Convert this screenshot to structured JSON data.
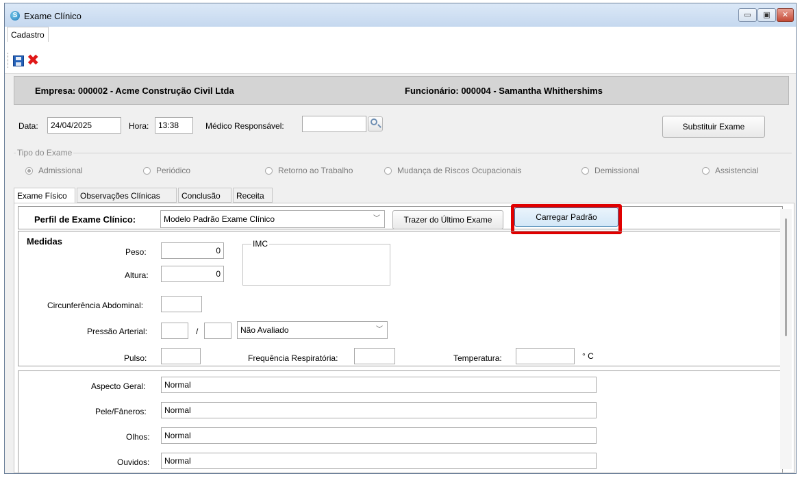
{
  "window": {
    "title": "Exame Clínico",
    "app_icon": "app-logo-icon",
    "min_label": "▭",
    "max_label": "▣",
    "close_label": "✕"
  },
  "menu": {
    "items": [
      "Cadastro"
    ]
  },
  "toolbar": {
    "save_icon": "save-icon",
    "delete_icon": "delete-icon",
    "delete_glyph": "✖"
  },
  "header": {
    "empresa": "Empresa:  000002 - Acme Construção Civil Ltda",
    "funcionario": "Funcionário:  000004 - Samantha Whithershims"
  },
  "form": {
    "data_label": "Data:",
    "data_value": "24/04/2025",
    "hora_label": "Hora:",
    "hora_value": "13:38",
    "medico_label": "Médico Responsável:",
    "medico_value": "",
    "substituir_label": "Substituir Exame"
  },
  "tipo_exame": {
    "legend": "Tipo do Exame",
    "options": [
      {
        "label": "Admissional",
        "selected": true
      },
      {
        "label": "Periódico",
        "selected": false
      },
      {
        "label": "Retorno ao Trabalho",
        "selected": false
      },
      {
        "label": "Mudança de Riscos Ocupacionais",
        "selected": false
      },
      {
        "label": "Demissional",
        "selected": false
      },
      {
        "label": "Assistencial",
        "selected": false
      }
    ]
  },
  "tabs": [
    "Exame Físico",
    "Observações Clínicas",
    "Conclusão",
    "Receita"
  ],
  "perfil": {
    "label": "Perfil de Exame Clínico:",
    "value": "Modelo Padrão Exame Clínico",
    "trazer_label": "Trazer do Último Exame",
    "carregar_label": "Carregar Padrão"
  },
  "medidas": {
    "title": "Medidas",
    "peso_label": "Peso:",
    "peso_value": "0",
    "altura_label": "Altura:",
    "altura_value": "0",
    "imc_label": "IMC",
    "circ_label": "Circunferência Abdominal:",
    "pressao_label": "Pressão Arterial:",
    "pressao_sep": "/",
    "pressao_status": "Não Avaliado",
    "pulso_label": "Pulso:",
    "freq_label": "Frequência Respiratória:",
    "temp_label": "Temperatura:",
    "temp_unit": "° C"
  },
  "exame": [
    {
      "label": "Aspecto Geral:",
      "value": "Normal"
    },
    {
      "label": "Pele/Fâneros:",
      "value": "Normal"
    },
    {
      "label": "Olhos:",
      "value": "Normal"
    },
    {
      "label": "Ouvidos:",
      "value": "Normal"
    }
  ]
}
